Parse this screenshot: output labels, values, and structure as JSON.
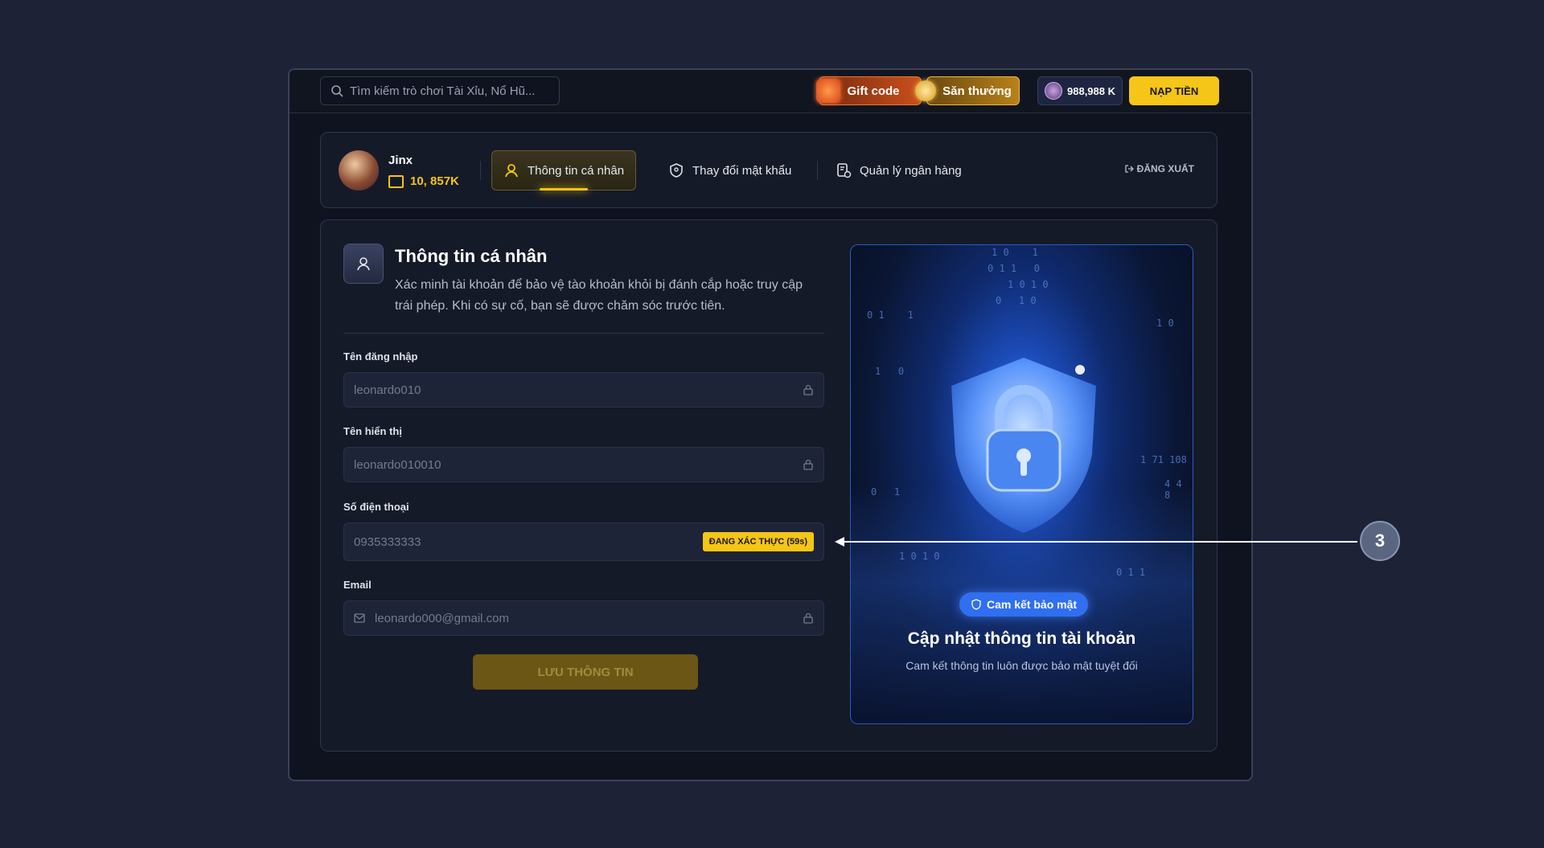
{
  "topbar": {
    "search_placeholder": "Tìm kiếm trò chơi Tài Xỉu, Nổ Hũ...",
    "gift_label": "Gift code",
    "hunt_label": "Săn thưởng",
    "coins": "988,988 K",
    "deposit_label": "NẠP TIỀN"
  },
  "profile": {
    "name": "Jinx",
    "balance": "10, 857K",
    "tabs": [
      {
        "label": "Thông tin cá nhân",
        "icon": "user-icon",
        "active": true
      },
      {
        "label": "Thay đổi mật khẩu",
        "icon": "shield-lock-icon",
        "active": false
      },
      {
        "label": "Quản lý ngân hàng",
        "icon": "bank-doc-icon",
        "active": false
      }
    ],
    "logout_label": "ĐĂNG XUẤT"
  },
  "form": {
    "title": "Thông tin cá nhân",
    "description": "Xác minh tài khoản để bảo vệ tào khoản khỏi bị đánh cắp hoặc truy cập trái phép. Khi có sự cố, bạn sẽ được chăm sóc trước tiên.",
    "fields": [
      {
        "label": "Tên đăng nhập",
        "value": "leonardo010"
      },
      {
        "label": "Tên hiển thị",
        "value": "leonardo010010"
      },
      {
        "label": "Số điện thoại",
        "value": "0935333333",
        "status": "ĐANG XÁC THỰC (59s)"
      },
      {
        "label": "Email",
        "value": "leonardo000@gmail.com"
      }
    ],
    "save_label": "LƯU THÔNG TIN"
  },
  "hero": {
    "badge": "Cam kết bảo mật",
    "title": "Cập nhật thông tin tài khoản",
    "subtitle": "Cam kết thông tin luôn được bảo mật tuyệt đối"
  },
  "annotation": {
    "number": "3"
  },
  "colors": {
    "accent": "#f5c518",
    "background": "#1d2236",
    "panel": "#151a28",
    "hero_blue": "#2f6ff0"
  }
}
